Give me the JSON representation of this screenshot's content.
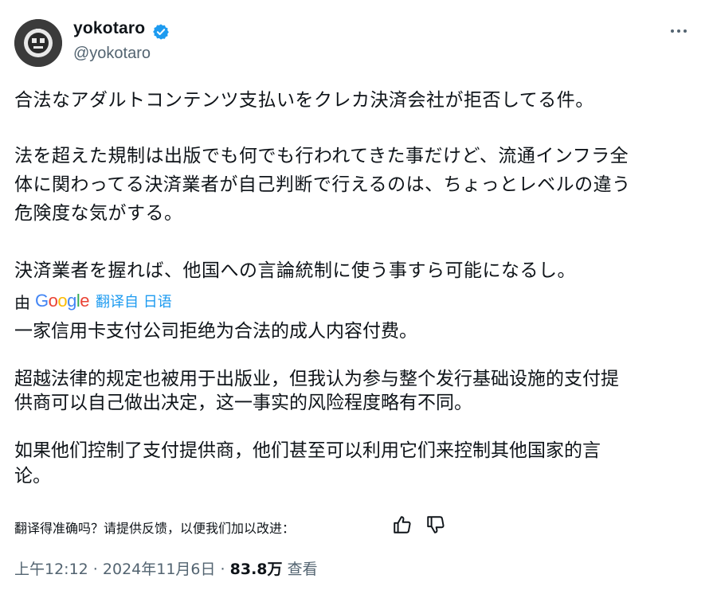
{
  "author": {
    "display_name": "yokotaro",
    "handle": "@yokotaro",
    "verified": true
  },
  "tweet": {
    "line1": "合法なアダルトコンテンツ支払いをクレカ決済会社が拒否してる件。",
    "para2_line1": "法を超えた規制は出版でも何でも行われてきた事だけど、流通インフラ全",
    "para2_line2": "体に関わってる決済業者が自己判断で行えるのは、ちょっとレベルの違う",
    "para2_line3": "危険度な気がする。",
    "para3_line1": "決済業者を握れば、他国への言論統制に使う事すら可能になるし。"
  },
  "translation": {
    "by_label": "由",
    "provider": "Google",
    "link_label": "翻译自 日语",
    "line1": "一家信用卡支付公司拒绝为合法的成人内容付费。",
    "para2_line1": "超越法律的规定也被用于出版业，但我认为参与整个发行基础设施的支付提",
    "para2_line2": "供商可以自己做出决定，这一事实的风险程度略有不同。",
    "para3_line1": "如果他们控制了支付提供商，他们甚至可以利用它们来控制其他国家的言",
    "para3_line2": "论。",
    "feedback_prompt": "翻译得准确吗？请提供反馈，以便我们加以改进："
  },
  "meta": {
    "time": "上午12:12",
    "separator": " · ",
    "date": "2024年11月6日",
    "views_count": "83.8万",
    "views_label": "查看"
  },
  "colors": {
    "text": "#0f1419",
    "secondary": "#536471",
    "link": "#1d9bf0",
    "verified": "#1d9bf0"
  },
  "icons": {
    "more": "more-dots-icon",
    "verified": "verified-badge-icon",
    "thumbs_up": "thumbs-up-icon",
    "thumbs_down": "thumbs-down-icon"
  }
}
